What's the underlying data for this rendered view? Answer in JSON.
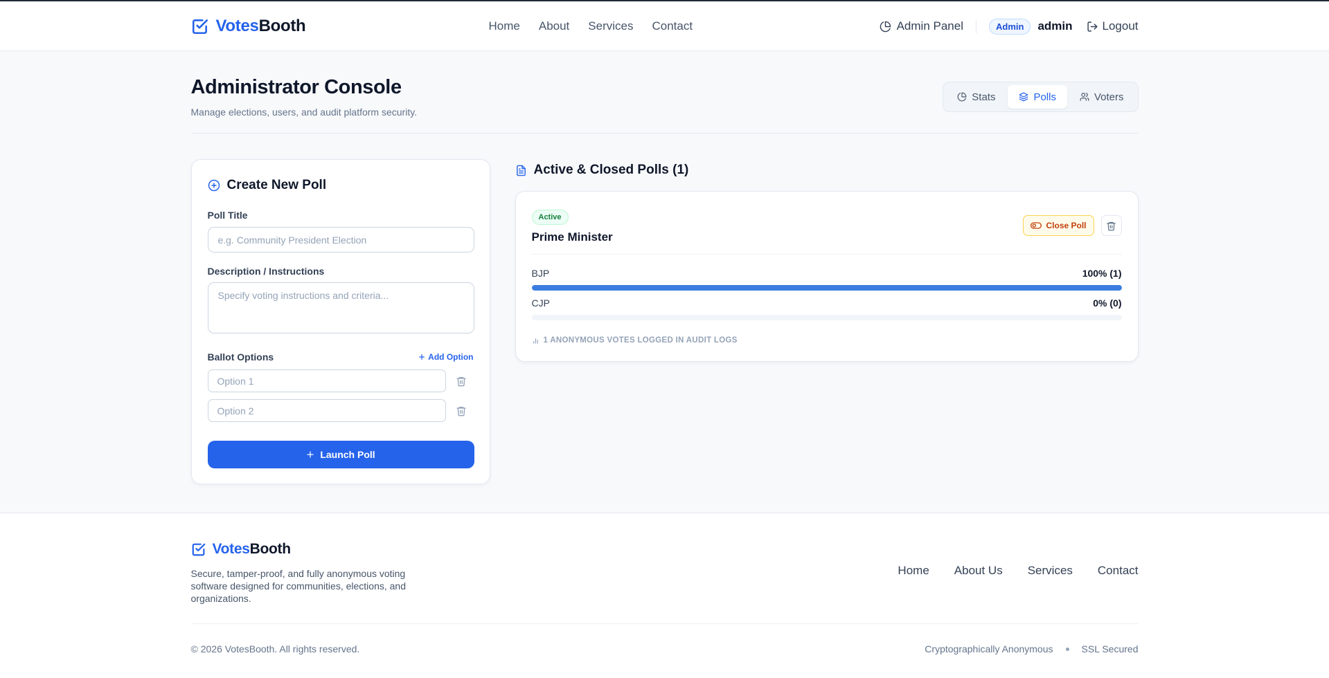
{
  "brand": {
    "part1": "Votes",
    "part2": "Booth"
  },
  "nav": [
    "Home",
    "About",
    "Services",
    "Contact"
  ],
  "header_right": {
    "admin_panel": "Admin Panel",
    "role_badge": "Admin",
    "username": "admin",
    "logout": "Logout"
  },
  "page": {
    "title": "Administrator Console",
    "subtitle": "Manage elections, users, and audit platform security."
  },
  "tabs": [
    {
      "label": "Stats",
      "icon": "pie-chart-icon",
      "active": false
    },
    {
      "label": "Polls",
      "icon": "layers-icon",
      "active": true
    },
    {
      "label": "Voters",
      "icon": "users-icon",
      "active": false
    }
  ],
  "create_poll": {
    "heading": "Create New Poll",
    "title_label": "Poll Title",
    "title_placeholder": "e.g. Community President Election",
    "title_value": "",
    "desc_label": "Description / Instructions",
    "desc_placeholder": "Specify voting instructions and criteria...",
    "desc_value": "",
    "options_label": "Ballot Options",
    "add_option": "Add Option",
    "options": [
      {
        "placeholder": "Option 1",
        "value": ""
      },
      {
        "placeholder": "Option 2",
        "value": ""
      }
    ],
    "launch": "Launch Poll"
  },
  "polls": {
    "heading": "Active & Closed Polls (1)",
    "items": [
      {
        "status": "Active",
        "title": "Prime Minister",
        "close_label": "Close Poll",
        "options": [
          {
            "name": "BJP",
            "result": "100% (1)",
            "fraction": 1.0
          },
          {
            "name": "CJP",
            "result": "0% (0)",
            "fraction": 0.0
          }
        ],
        "audit": "1 ANONYMOUS VOTES LOGGED IN AUDIT LOGS"
      }
    ]
  },
  "footer": {
    "brand_part1": "Votes",
    "brand_part2": "Booth",
    "description": "Secure, tamper-proof, and fully anonymous voting software designed for communities, elections, and organizations.",
    "links": [
      "Home",
      "About Us",
      "Services",
      "Contact"
    ],
    "copyright": "© 2026 VotesBooth. All rights reserved.",
    "tag1": "Cryptographically Anonymous",
    "tag2": "SSL Secured"
  },
  "colors": {
    "accent": "#2563eb",
    "bar_fill": "#3b7de0",
    "active_badge": "#15803d",
    "close_button": "#c2410c"
  }
}
